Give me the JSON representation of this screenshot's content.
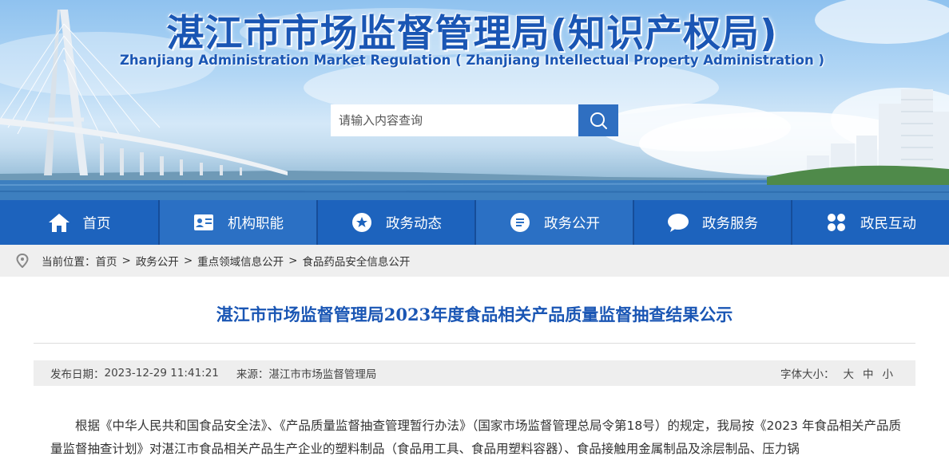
{
  "header": {
    "title_cn": "湛江市市场监督管理局(知识产权局)",
    "title_en": "Zhanjiang Administration Market Regulation ( Zhanjiang Intellectual Property Administration )"
  },
  "search": {
    "placeholder": "请输入内容查询",
    "icon": "search-icon"
  },
  "nav": {
    "items": [
      {
        "label": "首页",
        "icon": "home-icon"
      },
      {
        "label": "机构职能",
        "icon": "id-card-icon"
      },
      {
        "label": "政务动态",
        "icon": "star-circle-icon"
      },
      {
        "label": "政务公开",
        "icon": "document-list-icon"
      },
      {
        "label": "政务服务",
        "icon": "chat-bubble-icon"
      },
      {
        "label": "政民互动",
        "icon": "grid-icon"
      }
    ]
  },
  "breadcrumb": {
    "prefix": "当前位置：",
    "items": [
      "首页",
      "政务公开",
      "重点领域信息公开",
      "食品药品安全信息公开"
    ],
    "separator": ">"
  },
  "article": {
    "title": "湛江市市场监督管理局2023年度食品相关产品质量监督抽查结果公示",
    "publish_label": "发布日期：",
    "publish_date": "2023-12-29 11:41:21",
    "source_label": "来源：",
    "source": "湛江市市场监督管理局",
    "font_size_label": "字体大小：",
    "font_sizes": [
      "大",
      "中",
      "小"
    ],
    "paragraph": "根据《中华人民共和国食品安全法》、《产品质量监督抽查管理暂行办法》（国家市场监督管理总局令第18号）的规定，我局按《2023 年食品相关产品质量监督抽查计划》对湛江市食品相关产品生产企业的塑料制品（食品用工具、食品用塑料容器）、食品接触用金属制品及涂层制品、压力锅"
  },
  "colors": {
    "brand_blue": "#1a56b4",
    "nav_blue": "#1d63bd",
    "nav_active": "#2b70c4",
    "search_button": "#2f6fc1",
    "breadcrumb_bg": "#efefef",
    "meta_bg": "#eeeeee"
  }
}
